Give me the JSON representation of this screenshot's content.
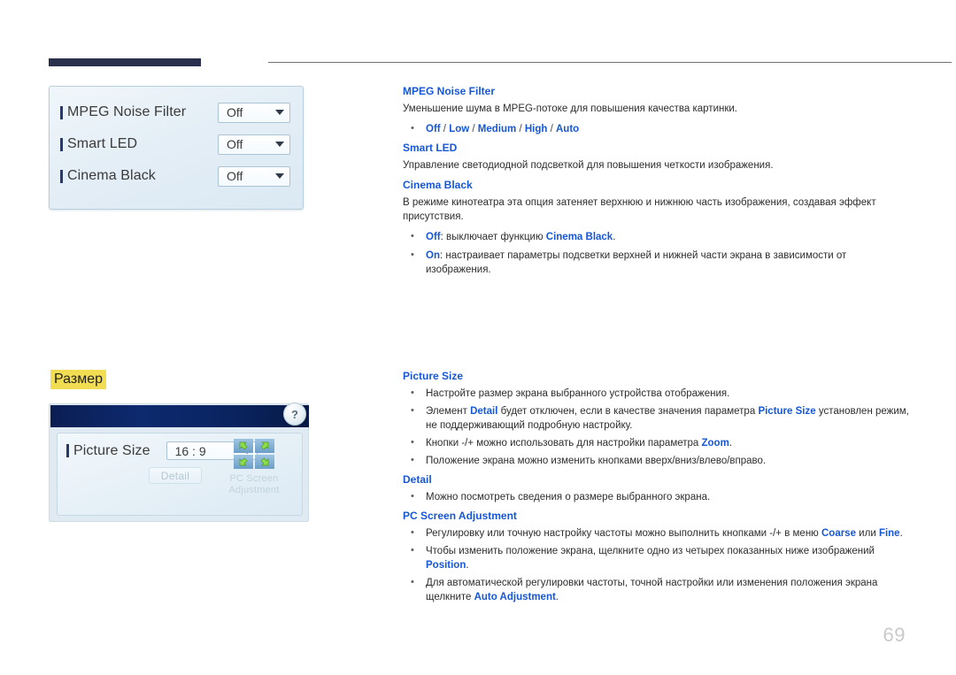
{
  "page": {
    "number": "69",
    "section_heading": "Размер"
  },
  "osd_panel_mpeg": {
    "rows": [
      {
        "label": "MPEG Noise Filter",
        "value": "Off"
      },
      {
        "label": "Smart LED",
        "value": "Off"
      },
      {
        "label": "Cinema Black",
        "value": "Off"
      }
    ]
  },
  "osd_window_picture_size": {
    "help_label": "?",
    "picture_size_label": "Picture Size",
    "picture_size_value": "16 : 9",
    "detail_button": "Detail",
    "pc_screen_adjustment_caption": "PC Screen Adjustment"
  },
  "sections": {
    "mpeg_noise_filter": {
      "heading": "MPEG Noise Filter",
      "body": "Уменьшение шума в MPEG-потоке для повышения качества картинки.",
      "options": [
        "Off",
        "Low",
        "Medium",
        "High",
        "Auto"
      ],
      "options_separator": "/"
    },
    "smart_led": {
      "heading": "Smart LED",
      "body": "Управление светодиодной подсветкой для повышения четкости изображения."
    },
    "cinema_black": {
      "heading": "Cinema Black",
      "body": "В режиме кинотеатра эта опция затеняет верхнюю и нижнюю часть изображения, создавая эффект присутствия.",
      "bullet_off_key": "Off",
      "bullet_off_text": ": выключает функцию ",
      "bullet_off_bold": "Cinema Black",
      "bullet_off_tail": ".",
      "bullet_on_key": "On",
      "bullet_on_text": ": настраивает параметры подсветки верхней и нижней части экрана в зависимости от изображения."
    },
    "picture_size": {
      "heading": "Picture Size",
      "b1": "Настройте размер экрана выбранного устройства отображения.",
      "b2_a": "Элемент ",
      "b2_k1": "Detail",
      "b2_b": " будет отключен, если в качестве значения параметра ",
      "b2_k2": "Picture Size",
      "b2_c": " установлен режим, не поддерживающий подробную настройку.",
      "b3_a": "Кнопки -/+ можно использовать для настройки параметра ",
      "b3_k": "Zoom",
      "b3_b": ".",
      "b4": "Положение экрана можно изменить кнопками вверх/вниз/влево/вправо."
    },
    "detail": {
      "heading": "Detail",
      "b1": "Можно посмотреть сведения о размере выбранного экрана."
    },
    "pc_screen_adjustment": {
      "heading": "PC Screen Adjustment",
      "b1_a": "Регулировку или точную настройку частоты можно выполнить кнопками -/+ в меню ",
      "b1_k1": "Coarse",
      "b1_b": " или ",
      "b1_k2": "Fine",
      "b1_c": ".",
      "b2_a": "Чтобы изменить положение экрана, щелкните одно из четырех показанных ниже изображений ",
      "b2_k": "Position",
      "b2_b": ".",
      "b3_a": "Для автоматической регулировки частоты, точной настройки или изменения положения экрана щелкните ",
      "b3_k": "Auto Adjustment",
      "b3_b": "."
    }
  },
  "colors": {
    "accent_blue": "#1757d6",
    "header_bar": "#2b2f4e",
    "highlight_yellow": "#f2dd52",
    "page_number_gray": "#c9cacc"
  }
}
